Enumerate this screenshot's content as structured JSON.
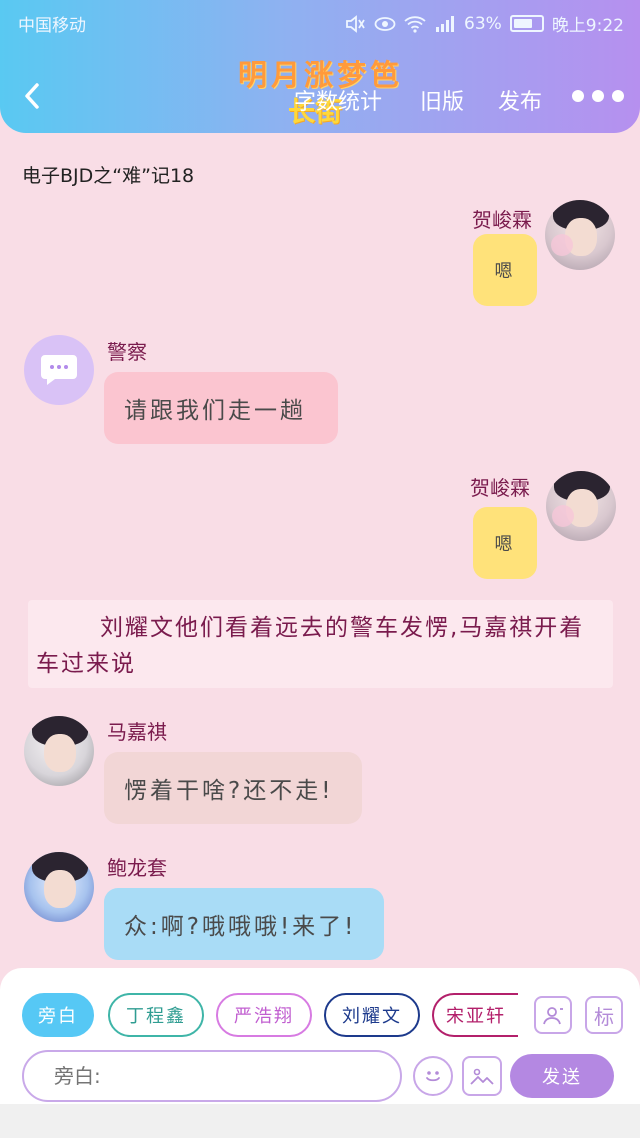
{
  "status_bar": {
    "carrier": "中国移动",
    "battery": "63%",
    "time": "晚上9:22"
  },
  "header": {
    "title_line1": "明月涨梦笆",
    "title_line2": "长街",
    "nav": [
      "字数统计",
      "旧版",
      "发布"
    ],
    "colors": {
      "gradient_start": "#59c9f2",
      "gradient_end": "#b690ef"
    }
  },
  "doc_title": "电子BJD之“难”记18",
  "messages": [
    {
      "sender": "贺峻霖",
      "text": "嗯",
      "side": "right"
    },
    {
      "sender": "警察",
      "text": "请跟我们走一趟",
      "side": "left"
    },
    {
      "sender": "贺峻霖",
      "text": "嗯",
      "side": "right"
    },
    {
      "sender": "马嘉祺",
      "text": "愣着干啥?还不走!",
      "side": "left"
    },
    {
      "sender": "鲍龙套",
      "text": "众:啊?哦哦哦!来了!",
      "side": "left"
    }
  ],
  "narration": "刘耀文他们看着远去的警车发愣,马嘉祺开着车过来说",
  "composer": {
    "tags": [
      "旁白",
      "丁程鑫",
      "严浩翔",
      "刘耀文",
      "宋亚轩"
    ],
    "label_button": "标",
    "input_placeholder": "旁白:",
    "send_label": "发送"
  },
  "icons": [
    "back-icon",
    "more-icon",
    "mute-icon",
    "eye-icon",
    "wifi-icon",
    "signal-icon",
    "battery-icon",
    "person-icon",
    "emoji-icon",
    "image-icon",
    "chat-bubble-icon"
  ]
}
